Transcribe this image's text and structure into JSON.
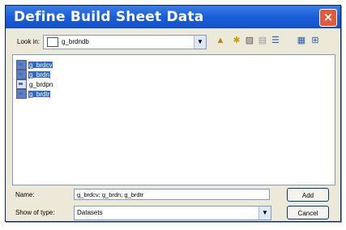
{
  "window": {
    "title": "Define Build Sheet Data",
    "close_glyph": "×"
  },
  "lookin": {
    "label": "Look in:",
    "value": "g_brdndb"
  },
  "toolbar": [
    {
      "name": "up-folder-icon",
      "glyph": "▲"
    },
    {
      "name": "new-folder-icon",
      "glyph": "✱"
    },
    {
      "name": "delete-icon",
      "glyph": "▨"
    },
    {
      "name": "properties-icon",
      "glyph": "▤"
    },
    {
      "name": "list-view-icon",
      "glyph": "☰"
    },
    {
      "name": "details-view-icon",
      "glyph": "▦"
    },
    {
      "name": "preview-view-icon",
      "glyph": "⊞"
    }
  ],
  "files": [
    {
      "name": "g_brdcv",
      "selected": true
    },
    {
      "name": "g_brdn",
      "selected": true
    },
    {
      "name": "g_brdpn",
      "selected": false
    },
    {
      "name": "g_brdtr",
      "selected": true
    }
  ],
  "name_field": {
    "label": "Name:",
    "value": "g_brdcv; g_brdn; g_brdtr"
  },
  "type_field": {
    "label": "Show of type:",
    "value": "Datasets"
  },
  "buttons": {
    "add": "Add",
    "cancel": "Cancel"
  }
}
